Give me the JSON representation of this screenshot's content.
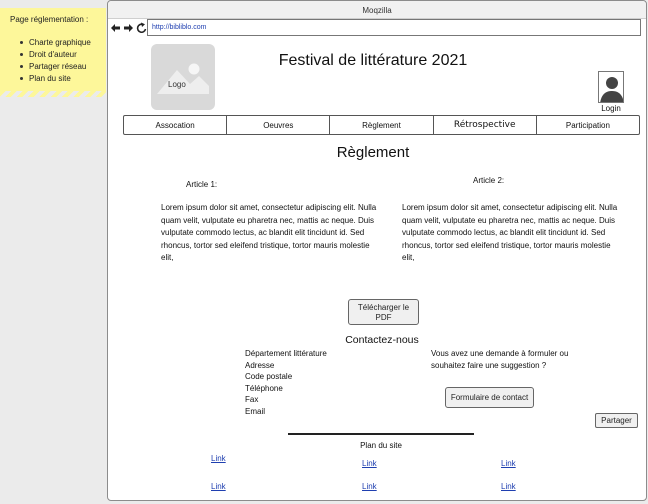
{
  "note": {
    "title": "Page réglementation :",
    "items": [
      "Charte graphique",
      "Droit d'auteur",
      "Partager réseau",
      "Plan du site"
    ]
  },
  "browser": {
    "title": "Moqzilla",
    "url": "http://bibliblo.com",
    "nav": {
      "back": "🡐",
      "forward": "🡒",
      "reload": "⟳"
    }
  },
  "header": {
    "logo": "Logo",
    "title": "Festival de littérature 2021",
    "login": "Login"
  },
  "tabs": [
    "Assocation",
    "Oeuvres",
    "Règlement",
    "Rétrospective",
    "Participation"
  ],
  "main": {
    "title": "Règlement",
    "articles": [
      {
        "heading": "Article 1:",
        "body": "Lorem ipsum dolor sit amet, consectetur adipiscing elit. Nulla quam velit, vulputate eu pharetra nec, mattis ac neque. Duis vulputate commodo lectus, ac blandit elit tincidunt id. Sed rhoncus, tortor sed eleifend tristique, tortor mauris molestie elit,"
      },
      {
        "heading": "Article 2:",
        "body": "Lorem ipsum dolor sit amet, consectetur adipiscing elit. Nulla quam velit, vulputate eu pharetra nec, mattis ac neque. Duis vulputate commodo lectus, ac blandit elit tincidunt id. Sed rhoncus, tortor sed eleifend tristique, tortor mauris molestie elit,"
      }
    ],
    "download_line1": "Télécharger le",
    "download_line2": "PDF"
  },
  "contact": {
    "title": "Contactez-nous",
    "items": [
      "Département littérature",
      "Adresse",
      "Code postale",
      "Téléphone",
      "Fax",
      "Email"
    ],
    "suggestion_line1": "Vous avez une demande à formuler ou",
    "suggestion_line2": "souhaitez faire une suggestion ?",
    "form_button": "Formulaire de contact",
    "share_button": "Partager"
  },
  "footer": {
    "plan_title": "Plan du site",
    "links": [
      "Link",
      "Link",
      "Link",
      "Link",
      "Link",
      "Link"
    ]
  }
}
